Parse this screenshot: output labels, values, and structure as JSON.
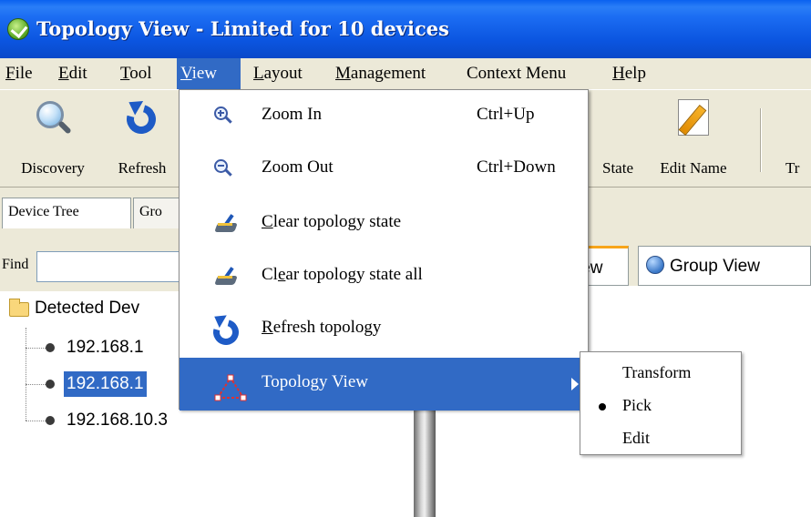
{
  "window": {
    "title": "Topology View - Limited for 10 devices"
  },
  "menubar": {
    "items": [
      {
        "label": "File",
        "hotkey": "F",
        "rest": "ile"
      },
      {
        "label": "Edit",
        "hotkey": "E",
        "rest": "dit"
      },
      {
        "label": "Tool",
        "hotkey": "T",
        "rest": "ool"
      },
      {
        "label": "View",
        "hotkey": "V",
        "rest": "iew"
      },
      {
        "label": "Layout",
        "hotkey": "L",
        "rest": "ayout"
      },
      {
        "label": "Management",
        "hotkey": "M",
        "rest": "anagement"
      },
      {
        "label": "Context Menu",
        "hotkey": "",
        "rest": "Context Menu"
      },
      {
        "label": "Help",
        "hotkey": "H",
        "rest": "elp"
      }
    ],
    "active": "View"
  },
  "toolbar": {
    "discovery": "Discovery",
    "refresh": "Refresh",
    "state": "State",
    "edit_name": "Edit Name",
    "tr": "Tr"
  },
  "left_panel": {
    "tabs": [
      "Device Tree",
      "Gro"
    ],
    "find_label": "Find",
    "find_value": "",
    "tree": {
      "root": "Detected Dev",
      "nodes": [
        "192.168.1",
        "192.168.1",
        "192.168.10.3"
      ],
      "selected_index": 1
    }
  },
  "right_tabs": {
    "view_tab": "iew",
    "group_tab": "Group View"
  },
  "view_menu": {
    "items": [
      {
        "label": "Zoom In",
        "shortcut": "Ctrl+Up",
        "icon": "zoom-in-icon"
      },
      {
        "label": "Zoom Out",
        "shortcut": "Ctrl+Down",
        "icon": "zoom-out-icon"
      },
      {
        "label_hotkey": "C",
        "label_rest": "lear topology state",
        "icon": "broom-icon"
      },
      {
        "label_pre": "Cl",
        "label_hotkey": "e",
        "label_rest": "ar topology state all",
        "icon": "broom-icon"
      },
      {
        "label_hotkey": "R",
        "label_rest": "efresh topology",
        "icon": "refresh-icon"
      },
      {
        "label": "Topology View",
        "icon": "topology-icon",
        "has_submenu": true
      }
    ],
    "highlighted": "Topology View"
  },
  "topology_submenu": {
    "items": [
      "Transform",
      "Pick",
      "Edit"
    ],
    "selected": "Pick"
  },
  "colors": {
    "selection": "#316ac5",
    "titlebar": "#0a55e0",
    "chrome": "#ece9d8"
  }
}
